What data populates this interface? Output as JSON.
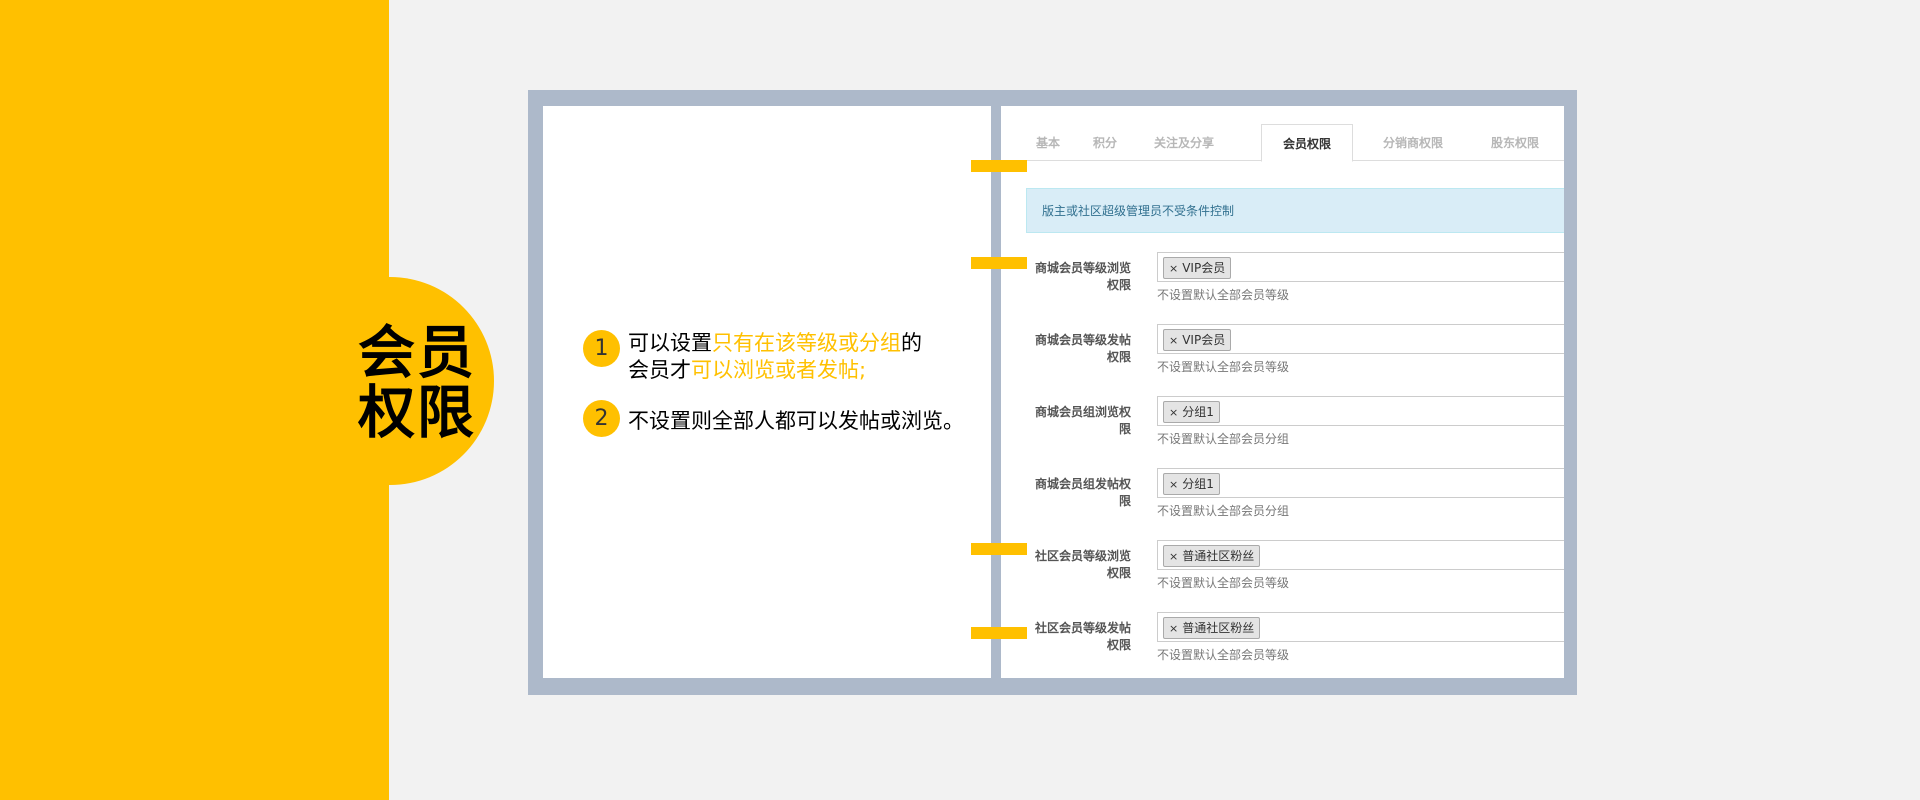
{
  "title": {
    "line1": "会员",
    "line2": "权限"
  },
  "steps": [
    {
      "num": "1",
      "pre": "可以设置",
      "hl1": "只有在该等级或分组",
      "mid": "的",
      "line2_pre": "会员才",
      "hl2": "可以浏览或者发帖;"
    },
    {
      "num": "2",
      "text": "不设置则全部人都可以发帖或浏览。"
    }
  ],
  "tabs": [
    "基本",
    "积分",
    "关注及分享",
    "会员权限",
    "分销商权限",
    "股东权限"
  ],
  "active_tab": "会员权限",
  "notice": "版主或社区超级管理员不受条件控制",
  "rows": [
    {
      "label1": "商城会员等级浏览",
      "label2": "权限",
      "tag": "VIP会员",
      "hint": "不设置默认全部会员等级"
    },
    {
      "label1": "商城会员等级发帖",
      "label2": "权限",
      "tag": "VIP会员",
      "hint": "不设置默认全部会员等级"
    },
    {
      "label1": "商城会员组浏览权",
      "label2": "限",
      "tag": "分组1",
      "hint": "不设置默认全部会员分组"
    },
    {
      "label1": "商城会员组发帖权",
      "label2": "限",
      "tag": "分组1",
      "hint": "不设置默认全部会员分组"
    },
    {
      "label1": "社区会员等级浏览",
      "label2": "权限",
      "tag": "普通社区粉丝",
      "hint": "不设置默认全部会员等级"
    },
    {
      "label1": "社区会员等级发帖",
      "label2": "权限",
      "tag": "普通社区粉丝",
      "hint": "不设置默认全部会员等级"
    }
  ],
  "tag_remove_symbol": "×",
  "colors": {
    "accent": "#FFC000",
    "frame": "#adb9ca",
    "notice_bg": "#d9edf7"
  }
}
